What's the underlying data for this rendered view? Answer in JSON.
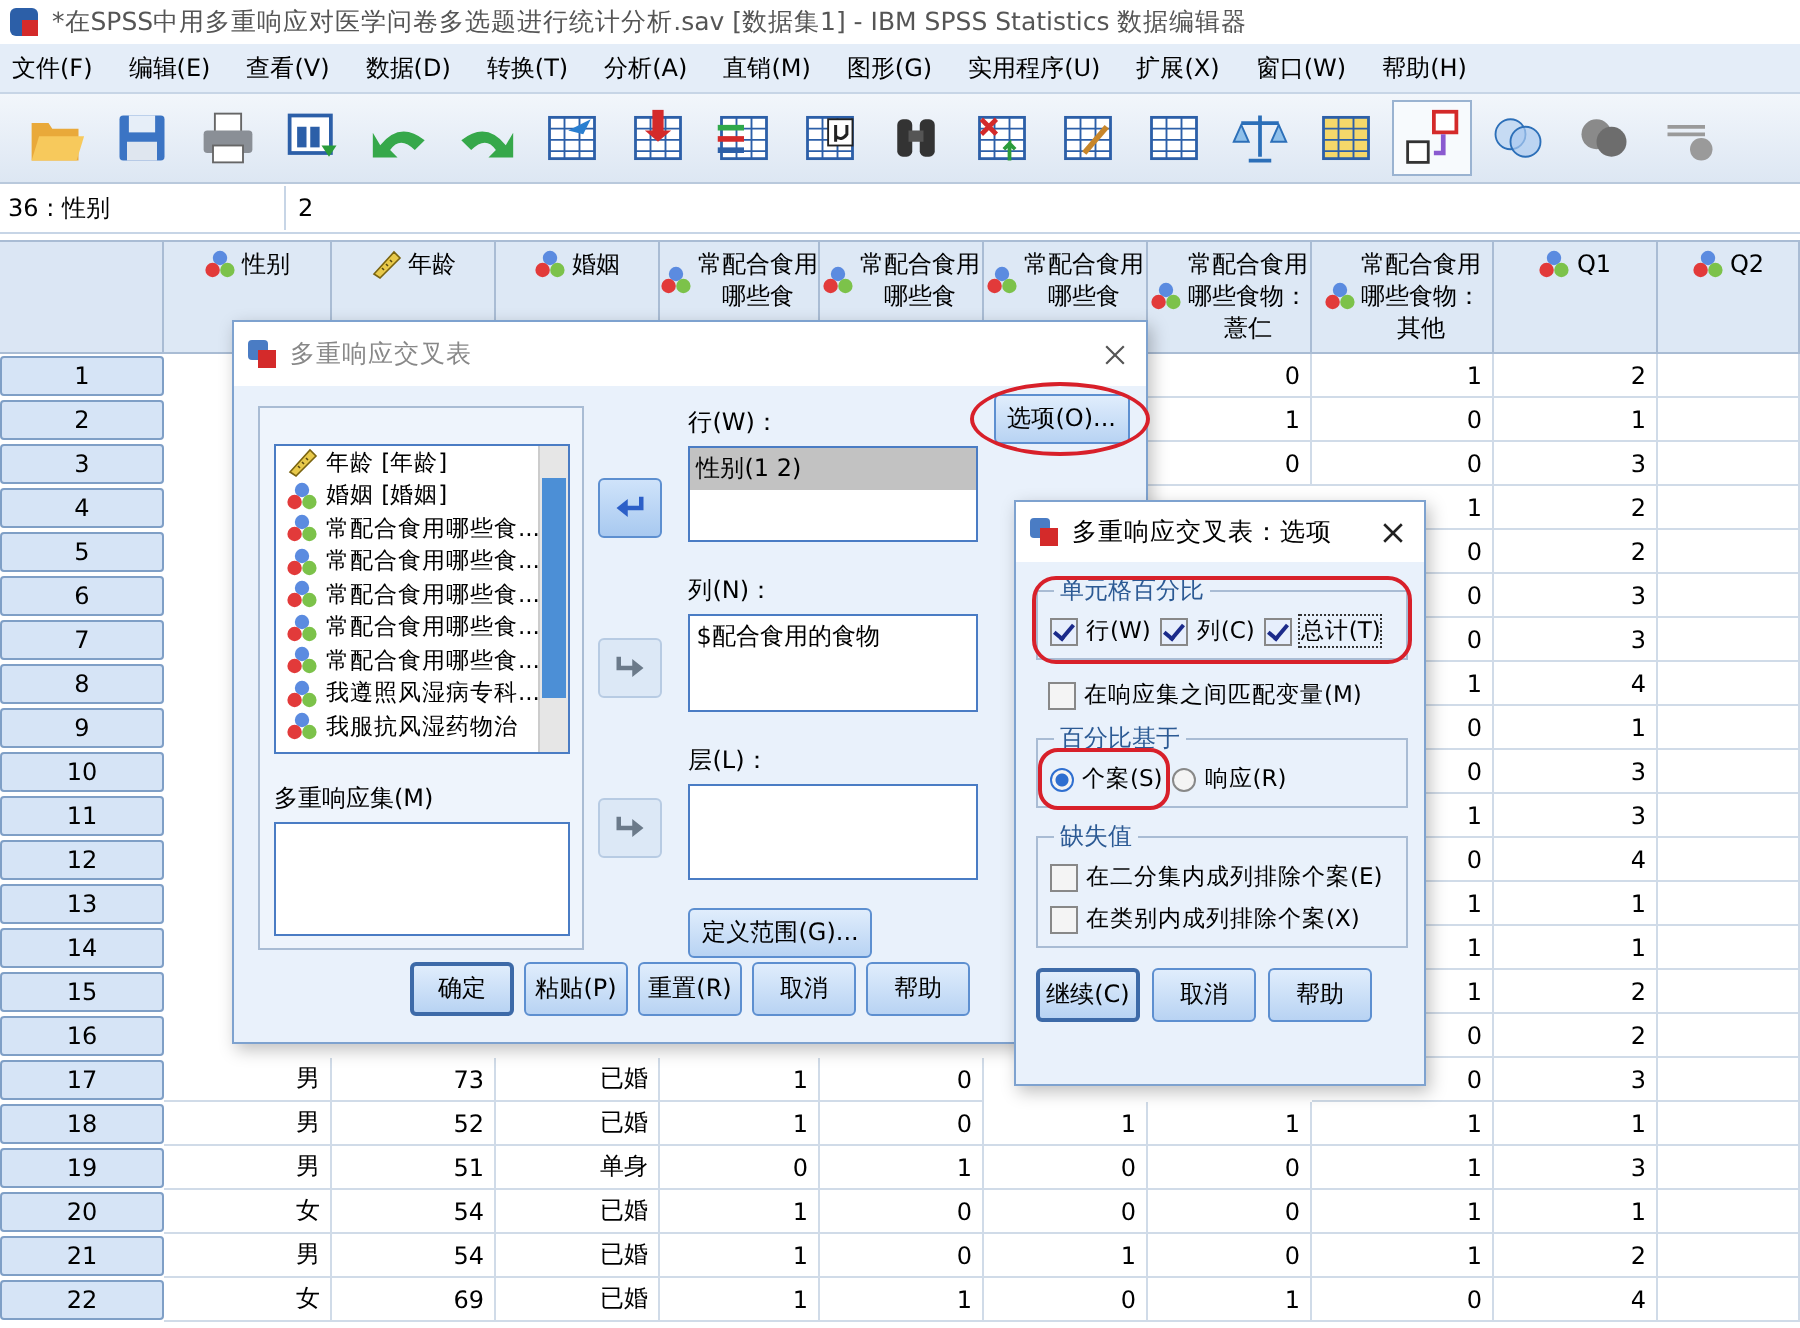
{
  "window": {
    "title": "*在SPSS中用多重响应对医学问卷多选题进行统计分析.sav [数据集1] - IBM SPSS Statistics 数据编辑器"
  },
  "menu": [
    "文件(F)",
    "编辑(E)",
    "查看(V)",
    "数据(D)",
    "转换(T)",
    "分析(A)",
    "直销(M)",
    "图形(G)",
    "实用程序(U)",
    "扩展(X)",
    "窗口(W)",
    "帮助(H)"
  ],
  "toolbar": [
    {
      "kind": "open",
      "pressed": false
    },
    {
      "kind": "save",
      "pressed": false
    },
    {
      "kind": "print",
      "pressed": false
    },
    {
      "kind": "recall",
      "pressed": false
    },
    {
      "kind": "undo",
      "pressed": false
    },
    {
      "kind": "redo",
      "pressed": false
    },
    {
      "kind": "goto_case",
      "pressed": false
    },
    {
      "kind": "goto_var",
      "pressed": false
    },
    {
      "kind": "variables",
      "pressed": false
    },
    {
      "kind": "stats",
      "pressed": false
    },
    {
      "kind": "find",
      "pressed": false
    },
    {
      "kind": "insert_cases",
      "pressed": false
    },
    {
      "kind": "insert_var",
      "pressed": false
    },
    {
      "kind": "split",
      "pressed": false
    },
    {
      "kind": "weight",
      "pressed": false
    },
    {
      "kind": "select",
      "pressed": false
    },
    {
      "kind": "labels",
      "pressed": true
    },
    {
      "kind": "sets",
      "pressed": false
    },
    {
      "kind": "sets_off",
      "pressed": false
    },
    {
      "kind": "spell",
      "pressed": false
    }
  ],
  "cell_editor": {
    "cell": "36 : 性别",
    "value": "2"
  },
  "grid": {
    "columns": [
      {
        "label": "性别",
        "kind": "nominal"
      },
      {
        "label": "年龄",
        "kind": "scale"
      },
      {
        "label": "婚姻",
        "kind": "nominal"
      },
      {
        "label": "常配合食用哪些食",
        "kind": "nominal"
      },
      {
        "label": "常配合食用哪些食",
        "kind": "nominal"
      },
      {
        "label": "常配合食用哪些食",
        "kind": "nominal"
      },
      {
        "label": "常配合食用哪些食物：薏仁",
        "kind": "nominal"
      },
      {
        "label": "常配合食用哪些食物：其他",
        "kind": "nominal"
      },
      {
        "label": "Q1",
        "kind": "nominal"
      },
      {
        "label": "Q2",
        "kind": "nominal"
      }
    ],
    "rows": [
      {
        "number": "1",
        "cells": [
          null,
          null,
          null,
          null,
          null,
          null,
          "0",
          "1",
          "2"
        ]
      },
      {
        "number": "2",
        "cells": [
          null,
          null,
          null,
          null,
          null,
          null,
          "1",
          "0",
          "1"
        ]
      },
      {
        "number": "3",
        "cells": [
          null,
          null,
          null,
          null,
          null,
          null,
          "0",
          "0",
          "3"
        ]
      },
      {
        "number": "4",
        "cells": [
          null,
          null,
          null,
          null,
          null,
          null,
          null,
          "1",
          "2"
        ]
      },
      {
        "number": "5",
        "cells": [
          null,
          null,
          null,
          null,
          null,
          null,
          null,
          "0",
          "2"
        ]
      },
      {
        "number": "6",
        "cells": [
          null,
          null,
          null,
          null,
          null,
          null,
          null,
          "0",
          "3"
        ]
      },
      {
        "number": "7",
        "cells": [
          null,
          null,
          null,
          null,
          null,
          null,
          null,
          "0",
          "3"
        ]
      },
      {
        "number": "8",
        "cells": [
          null,
          null,
          null,
          null,
          null,
          null,
          null,
          "1",
          "4"
        ]
      },
      {
        "number": "9",
        "cells": [
          null,
          null,
          null,
          null,
          null,
          null,
          null,
          "0",
          "1"
        ]
      },
      {
        "number": "10",
        "cells": [
          null,
          null,
          null,
          null,
          null,
          null,
          null,
          "0",
          "3"
        ]
      },
      {
        "number": "11",
        "cells": [
          null,
          null,
          null,
          null,
          null,
          null,
          null,
          "1",
          "3"
        ]
      },
      {
        "number": "12",
        "cells": [
          null,
          null,
          null,
          null,
          null,
          null,
          null,
          "0",
          "4"
        ]
      },
      {
        "number": "13",
        "cells": [
          null,
          null,
          null,
          null,
          null,
          null,
          null,
          "1",
          "1"
        ]
      },
      {
        "number": "14",
        "cells": [
          null,
          null,
          null,
          null,
          null,
          null,
          null,
          "1",
          "1"
        ]
      },
      {
        "number": "15",
        "cells": [
          null,
          null,
          null,
          null,
          null,
          null,
          null,
          "1",
          "2"
        ]
      },
      {
        "number": "16",
        "cells": [
          null,
          null,
          null,
          null,
          null,
          null,
          null,
          "0",
          "2"
        ]
      },
      {
        "number": "17",
        "cells": [
          "男",
          "73",
          "已婚",
          "1",
          "0",
          null,
          null,
          "0",
          "3"
        ]
      },
      {
        "number": "18",
        "cells": [
          "男",
          "52",
          "已婚",
          "1",
          "0",
          "1",
          "1",
          "1",
          "1"
        ]
      },
      {
        "number": "19",
        "cells": [
          "男",
          "51",
          "单身",
          "0",
          "1",
          "0",
          "0",
          "1",
          "3"
        ]
      },
      {
        "number": "20",
        "cells": [
          "女",
          "54",
          "已婚",
          "1",
          "0",
          "0",
          "0",
          "1",
          "1"
        ]
      },
      {
        "number": "21",
        "cells": [
          "男",
          "54",
          "已婚",
          "1",
          "0",
          "1",
          "0",
          "1",
          "2"
        ]
      },
      {
        "number": "22",
        "cells": [
          "女",
          "69",
          "已婚",
          "1",
          "1",
          "0",
          "1",
          "0",
          "4"
        ]
      }
    ]
  },
  "crosstabs_dialog": {
    "title": "多重响应交叉表",
    "variables": [
      {
        "label": "年龄 [年龄]",
        "kind": "scale"
      },
      {
        "label": "婚姻 [婚姻]",
        "kind": "nominal"
      },
      {
        "label": "常配合食用哪些食...",
        "kind": "nominal"
      },
      {
        "label": "常配合食用哪些食...",
        "kind": "nominal"
      },
      {
        "label": "常配合食用哪些食...",
        "kind": "nominal"
      },
      {
        "label": "常配合食用哪些食...",
        "kind": "nominal"
      },
      {
        "label": "常配合食用哪些食...",
        "kind": "nominal"
      },
      {
        "label": "我遵照风湿病专科...",
        "kind": "nominal"
      },
      {
        "label": "我服抗风湿药物治",
        "kind": "nominal"
      }
    ],
    "sets_label": "多重响应集(M)",
    "arrows": [
      {
        "disabled": false
      },
      {
        "disabled": true
      },
      {
        "disabled": true
      }
    ],
    "rows_label": "行(W)：",
    "rows_items": [
      {
        "label": "性别(1 2)",
        "selected": true
      }
    ],
    "columns_label": "列(N)：",
    "columns_items": [
      {
        "label": "$配合食用的食物",
        "selected": false
      }
    ],
    "layers_label": "层(L)：",
    "define_range": "定义范围(G)...",
    "options_button": {
      "label": "选项(O)...",
      "highlighted": true
    },
    "buttons": [
      {
        "label": "确定",
        "default": true
      },
      {
        "label": "粘贴(P)",
        "default": false
      },
      {
        "label": "重置(R)",
        "default": false
      },
      {
        "label": "取消",
        "default": false
      },
      {
        "label": "帮助",
        "default": false
      }
    ]
  },
  "options_dialog": {
    "title": "多重响应交叉表：选项",
    "cell_percentages": {
      "title": "单元格百分比",
      "highlighted": true,
      "items": [
        {
          "label": "行(W)",
          "checked": true
        },
        {
          "label": "列(C)",
          "checked": true
        },
        {
          "label": "总计(T)",
          "checked": true
        }
      ]
    },
    "match_variables": {
      "label": "在响应集之间匹配变量(M)",
      "checked": false
    },
    "percent_base": {
      "title": "百分比基于",
      "items": [
        {
          "label": "个案(S)",
          "selected": true,
          "highlighted": true
        },
        {
          "label": "响应(R)",
          "selected": false,
          "highlighted": false
        }
      ]
    },
    "missing": {
      "title": "缺失值",
      "items": [
        {
          "label": "在二分集内成列排除个案(E)",
          "checked": false
        },
        {
          "label": "在类别内成列排除个案(X)",
          "checked": false
        }
      ]
    },
    "buttons": [
      {
        "label": "继续(C)",
        "default": true
      },
      {
        "label": "取消",
        "default": false
      },
      {
        "label": "帮助",
        "default": false
      }
    ]
  }
}
